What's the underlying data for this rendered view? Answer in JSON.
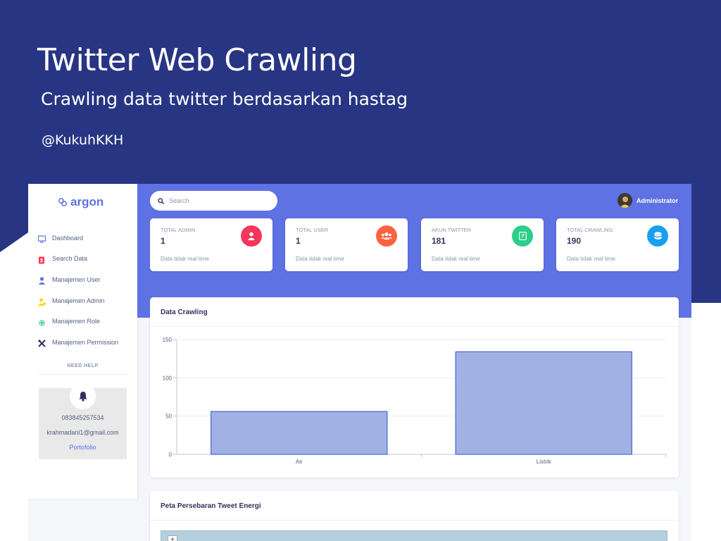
{
  "promo": {
    "title": "Twitter Web Crawling",
    "subtitle": "Crawling data twitter berdasarkan hastag",
    "handle": "@KukuhKKH"
  },
  "colors": {
    "banner": "#283583",
    "primary": "#5e72e4",
    "danger": "#f5365c",
    "warning": "#fb6340",
    "success": "#2dce89",
    "info": "#11cdef",
    "bar_fill": "#9fb2e3",
    "bar_stroke": "#4c63d2"
  },
  "sidebar": {
    "brand": "argon",
    "items": [
      {
        "label": "Dashboard",
        "icon": "monitor-icon"
      },
      {
        "label": "Search Data",
        "icon": "search-data-icon"
      },
      {
        "label": "Manajemen User",
        "icon": "user-icon"
      },
      {
        "label": "Manajemen Admin",
        "icon": "admin-icon"
      },
      {
        "label": "Manajemen Role",
        "icon": "gear-icon"
      },
      {
        "label": "Manajemen Permission",
        "icon": "tools-icon"
      }
    ],
    "help_heading": "NEED HELP",
    "help_phone": "083845257534",
    "help_email": "krahmadani1@gmail.com",
    "help_link": "Portofolio"
  },
  "header": {
    "search_placeholder": "Search",
    "user_name": "Administrator"
  },
  "stats": [
    {
      "title": "TOTAL ADMIN",
      "value": "1",
      "footer": "Data tidak real time",
      "icon": "user-icon",
      "color": "#f5365c"
    },
    {
      "title": "TOTAL USER",
      "value": "1",
      "footer": "Data tidak real time",
      "icon": "users-icon",
      "color": "#fb6340"
    },
    {
      "title": "AKUN TWITTER",
      "value": "181",
      "footer": "Data tidak real time",
      "icon": "twitter-account-icon",
      "color": "#2dce89"
    },
    {
      "title": "TOTAL CRAWLING",
      "value": "190",
      "footer": "Data tidak real time",
      "icon": "database-icon",
      "color": "#11cdef"
    }
  ],
  "chart_card": {
    "title": "Data Crawling"
  },
  "map_card": {
    "title": "Peta Persebaran Tweet Energi",
    "zoom_label": "+"
  },
  "chart_data": {
    "type": "bar",
    "categories": [
      "Air",
      "Listrik"
    ],
    "values": [
      56,
      134
    ],
    "title": "",
    "xlabel": "",
    "ylabel": "",
    "ylim": [
      0,
      150
    ],
    "yticks": [
      0,
      50,
      100,
      150
    ],
    "grid": true
  }
}
